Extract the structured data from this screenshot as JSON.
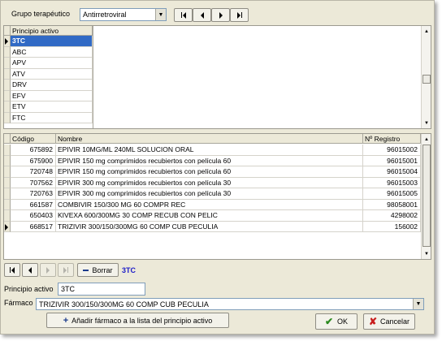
{
  "top": {
    "group_label": "Grupo terapéutico",
    "group_value": "Antirretroviral",
    "nav": [
      "first",
      "prev",
      "next",
      "last"
    ]
  },
  "active_grid": {
    "header": "Principio activo",
    "rows": [
      "3TC",
      "ABC",
      "APV",
      "ATV",
      "DRV",
      "EFV",
      "ETV",
      "FTC"
    ],
    "selected_index": 0
  },
  "drug_grid": {
    "headers": {
      "code": "Código",
      "name": "Nombre",
      "reg": "Nº Registro"
    },
    "rows": [
      {
        "code": "675892",
        "name": "EPIVIR 10MG/ML 240ML SOLUCION ORAL",
        "reg": "96015002"
      },
      {
        "code": "675900",
        "name": "EPIVIR 150 mg comprimidos recubiertos con película 60",
        "reg": "96015001"
      },
      {
        "code": "720748",
        "name": "EPIVIR 150 mg comprimidos recubiertos con película 60",
        "reg": "96015004"
      },
      {
        "code": "707562",
        "name": "EPIVIR 300 mg comprimidos recubiertos con película 30",
        "reg": "96015003"
      },
      {
        "code": "720763",
        "name": "EPIVIR 300 mg comprimidos recubiertos con película 30",
        "reg": "96015005"
      },
      {
        "code": "661587",
        "name": "COMBIVIR 150/300 MG 60 COMPR REC",
        "reg": "98058001"
      },
      {
        "code": "650403",
        "name": "KIVEXA 600/300MG 30 COMP RECUB CON PELIC",
        "reg": "4298002"
      },
      {
        "code": "668517",
        "name": "TRIZIVIR 300/150/300MG 60 COMP CUB PECULIA",
        "reg": "156002"
      }
    ],
    "current_index": 7
  },
  "navbar": {
    "delete_label": "Borrar",
    "current_label": "3TC"
  },
  "form": {
    "active_label": "Principio activo",
    "active_value": "3TC",
    "drug_label": "Fármaco",
    "drug_value": "TRIZIVIR 300/150/300MG 60 COMP CUB PECULIA",
    "add_label": "Añadir fármaco a la lista del principio activo",
    "ok_label": "OK",
    "cancel_label": "Cancelar"
  },
  "colors": {
    "selected_bg": "#316ac5",
    "accent_text": "#1c1cc8",
    "ok_check": "#2a8a1e",
    "cancel_x": "#c81e1e",
    "add_plus": "#1a3a8c"
  }
}
